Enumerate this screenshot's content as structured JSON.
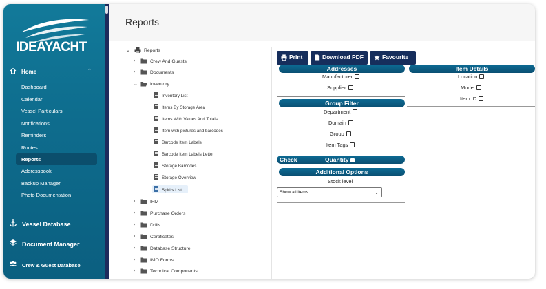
{
  "app": {
    "brand": "IDEAYACHT"
  },
  "page": {
    "title": "Reports"
  },
  "sidebar": {
    "home_label": "Home",
    "items": [
      {
        "label": "Dashboard"
      },
      {
        "label": "Calendar"
      },
      {
        "label": "Vessel Particulars"
      },
      {
        "label": "Notifications"
      },
      {
        "label": "Reminders"
      },
      {
        "label": "Routes"
      },
      {
        "label": "Reports",
        "active": true
      },
      {
        "label": "Addressbook"
      },
      {
        "label": "Backup Manager"
      },
      {
        "label": "Photo Documentation"
      }
    ],
    "sections": [
      {
        "label": "Vessel Database",
        "icon": "anchor-icon"
      },
      {
        "label": "Document Manager",
        "icon": "layers-icon"
      },
      {
        "label": "Crew & Guest Database",
        "icon": "users-icon"
      }
    ]
  },
  "tree": {
    "root": "Reports",
    "nodes": [
      {
        "label": "Crew And Guests",
        "type": "folder",
        "expanded": false
      },
      {
        "label": "Documents",
        "type": "folder",
        "expanded": false
      },
      {
        "label": "Inventory",
        "type": "folder",
        "expanded": true
      },
      {
        "label": "Inventory List",
        "type": "report"
      },
      {
        "label": "Items By Storage Area",
        "type": "report"
      },
      {
        "label": "Items With Values And Totals",
        "type": "report"
      },
      {
        "label": "Item with pictures and barcodes",
        "type": "report"
      },
      {
        "label": "Barcode Item Labels",
        "type": "report"
      },
      {
        "label": "Barcode Item Labels Letter",
        "type": "report"
      },
      {
        "label": "Storage Barcodes",
        "type": "report"
      },
      {
        "label": "Storage Overview",
        "type": "report"
      },
      {
        "label": "Spirits List",
        "type": "report",
        "selected": true
      },
      {
        "label": "IHM",
        "type": "folder",
        "expanded": false
      },
      {
        "label": "Purchase Orders",
        "type": "folder",
        "expanded": false
      },
      {
        "label": "Drills",
        "type": "folder",
        "expanded": false
      },
      {
        "label": "Certificates",
        "type": "folder",
        "expanded": false
      },
      {
        "label": "Database Structure",
        "type": "folder",
        "expanded": false
      },
      {
        "label": "IMO Forms",
        "type": "folder",
        "expanded": false
      },
      {
        "label": "Technical Components",
        "type": "folder",
        "expanded": false
      }
    ]
  },
  "toolbar": {
    "print_label": "Print",
    "pdf_label": "Download PDF",
    "favourite_label": "Favourite"
  },
  "options": {
    "addresses": {
      "title": "Addresses",
      "fields": [
        "Manufacturer",
        "Supplier"
      ]
    },
    "item_details": {
      "title": "Item Details",
      "fields": [
        "Location",
        "Model",
        "Item ID"
      ]
    },
    "group_filter": {
      "title": "Group Filter",
      "fields": [
        "Department",
        "Domain",
        "Group",
        "Item Tags"
      ]
    },
    "check": {
      "label": "Check",
      "quantity_label": "Quantity"
    },
    "additional": {
      "title": "Additional Options",
      "stock_level_label": "Stock level",
      "stock_level_value": "Show all items"
    }
  },
  "colors": {
    "sidebar": "#0e6d8e",
    "button": "#162e5c",
    "section_header": "#0a5a80"
  }
}
